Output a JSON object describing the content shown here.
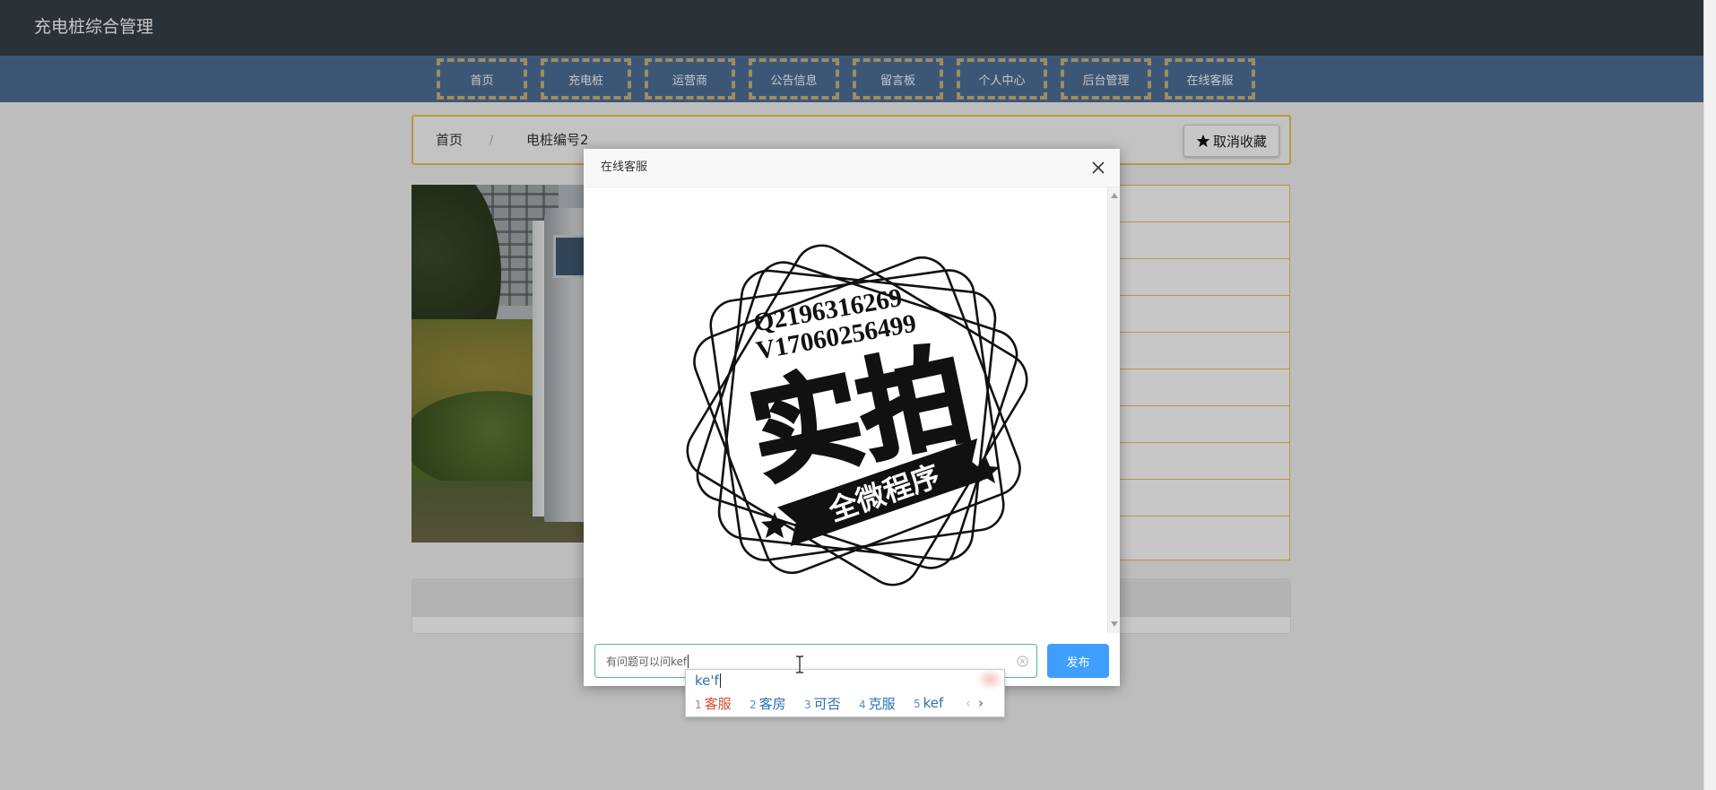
{
  "app": {
    "title": "充电桩综合管理"
  },
  "nav": {
    "items": [
      "首页",
      "充电桩",
      "运营商",
      "公告信息",
      "留言板",
      "个人中心",
      "后台管理",
      "在线客服"
    ]
  },
  "breadcrumb": {
    "home": "首页",
    "separator": "/",
    "current": "电桩编号2"
  },
  "favorite_button": {
    "icon": "star-icon",
    "label": "取消收藏"
  },
  "modal": {
    "title": "在线客服",
    "close_icon": "close-icon",
    "image": {
      "contact_line_1": "Q2196316269",
      "contact_line_2": "V17060256499",
      "headline": "实拍",
      "banner": "全微程序"
    },
    "input": {
      "value": "有问题可以问kef",
      "clear_icon": "clear-icon"
    },
    "submit_label": "发布",
    "scroll_icons": [
      "scroll-up-icon",
      "scroll-down-icon"
    ]
  },
  "ime": {
    "composition": "ke'f",
    "candidates": [
      {
        "index": "1",
        "text": "客服"
      },
      {
        "index": "2",
        "text": "客房"
      },
      {
        "index": "3",
        "text": "可否"
      },
      {
        "index": "4",
        "text": "克服"
      },
      {
        "index": "5",
        "text": "kef"
      }
    ],
    "prev_label": "‹",
    "next_label": "›"
  },
  "colors": {
    "header_bg": "#373f47",
    "nav_bg": "#4d7098",
    "nav_border": "#cdb47a",
    "accent_gold": "#f0c050",
    "primary_button": "#409eff",
    "input_focus_border": "#52b893",
    "ime_first_candidate": "#d24c35",
    "ime_candidate": "#2d6fb5"
  }
}
